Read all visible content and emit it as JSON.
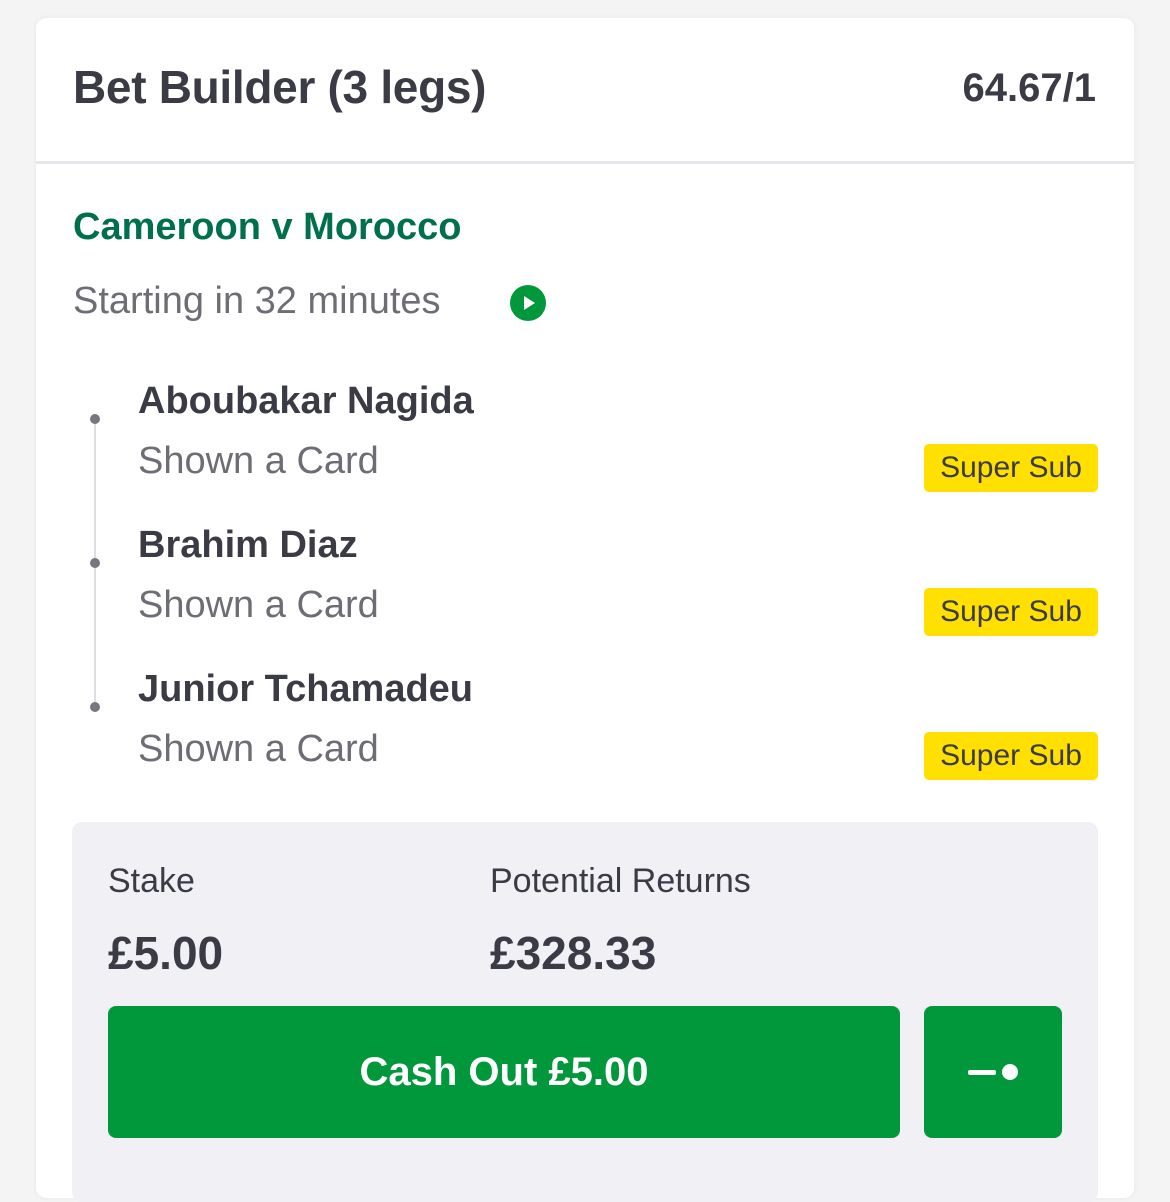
{
  "bet": {
    "title": "Bet Builder (3 legs)",
    "odds": "64.67/1"
  },
  "match": {
    "title": "Cameroon v Morocco",
    "status": "Starting in 32 minutes",
    "status_icon": "play-icon"
  },
  "legs": [
    {
      "name": "Aboubakar Nagida",
      "market": "Shown a Card",
      "badge": "Super Sub"
    },
    {
      "name": "Brahim Diaz",
      "market": "Shown a Card",
      "badge": "Super Sub"
    },
    {
      "name": "Junior Tchamadeu",
      "market": "Shown a Card",
      "badge": "Super Sub"
    }
  ],
  "summary": {
    "stake_label": "Stake",
    "stake_value": "£5.00",
    "returns_label": "Potential Returns",
    "returns_value": "£328.33"
  },
  "actions": {
    "cashout_label": "Cash Out £5.00",
    "partial_icon": "slider-icon"
  },
  "colors": {
    "brand_green": "#00983a",
    "match_green": "#00704a",
    "badge_yellow": "#ffe000",
    "text_dark": "#3a3b45",
    "text_muted": "#6d6d75"
  }
}
